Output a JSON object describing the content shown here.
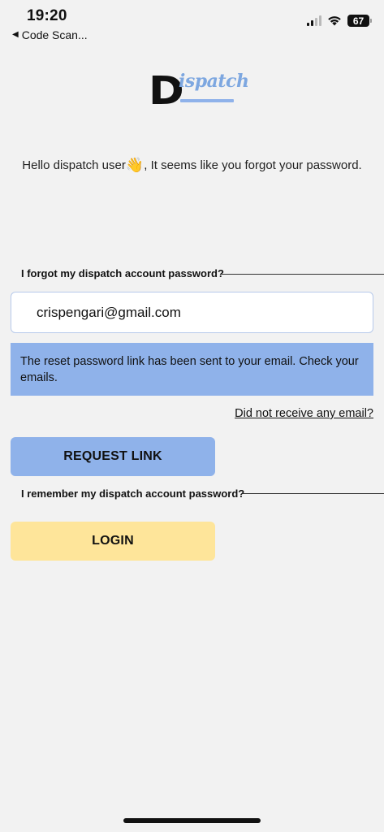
{
  "status_bar": {
    "time": "19:20",
    "back_app": "Code Scan...",
    "battery": "67"
  },
  "logo": {
    "letter": "D",
    "text": "ispatch"
  },
  "greeting": {
    "before": "Hello dispatch user",
    "emoji": "👋",
    "after": ", It seems like you forgot your password."
  },
  "forgot_section": {
    "title": "I forgot my dispatch account password?"
  },
  "email_field": {
    "value": "crispengari@gmail.com"
  },
  "notice": {
    "message": "The reset password link has been sent to your email. Check your emails."
  },
  "resend_link": {
    "label": "Did not receive any email?"
  },
  "request_button": {
    "label": "REQUEST LINK"
  },
  "remember_section": {
    "title": "I remember my dispatch account password?"
  },
  "login_button": {
    "label": "LOGIN"
  },
  "colors": {
    "background": "#f2f2f2",
    "primary_blue": "#8fb2ea",
    "login_yellow": "#fee59a",
    "logo_blue": "#7da7e0"
  }
}
